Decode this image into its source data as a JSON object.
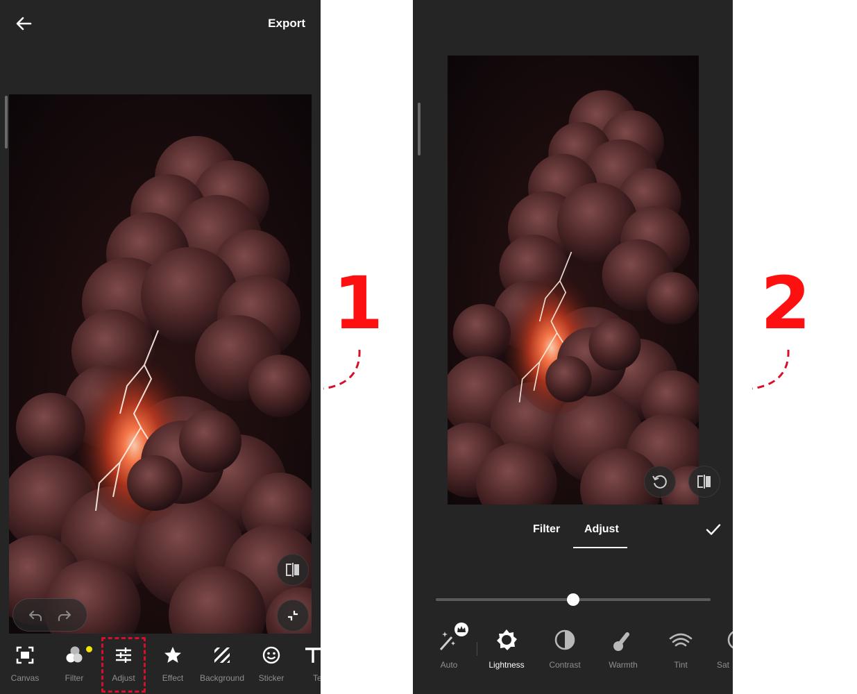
{
  "screen1": {
    "header": {
      "export_label": "Export"
    },
    "toolbar": [
      {
        "id": "canvas",
        "label": "Canvas"
      },
      {
        "id": "filter",
        "label": "Filter"
      },
      {
        "id": "adjust",
        "label": "Adjust"
      },
      {
        "id": "effect",
        "label": "Effect"
      },
      {
        "id": "background",
        "label": "Background"
      },
      {
        "id": "sticker",
        "label": "Sticker"
      },
      {
        "id": "text",
        "label": "Te"
      }
    ],
    "step_number": "1"
  },
  "screen2": {
    "tabs": [
      {
        "label": "Filter"
      },
      {
        "label": "Adjust"
      }
    ],
    "active_tab": "Adjust",
    "slider": {
      "value_fraction": 0.5
    },
    "tools": [
      {
        "id": "auto",
        "label": "Auto",
        "premium": true
      },
      {
        "id": "lightness",
        "label": "Lightness",
        "active": true
      },
      {
        "id": "contrast",
        "label": "Contrast"
      },
      {
        "id": "warmth",
        "label": "Warmth"
      },
      {
        "id": "tint",
        "label": "Tint"
      },
      {
        "id": "saturation",
        "label": "Sat"
      }
    ],
    "step_number": "2"
  },
  "colors": {
    "background": "#252525",
    "accent_red": "#ff1010",
    "highlight_dashed": "#d6102a",
    "label_gray": "#8f8f8f"
  }
}
